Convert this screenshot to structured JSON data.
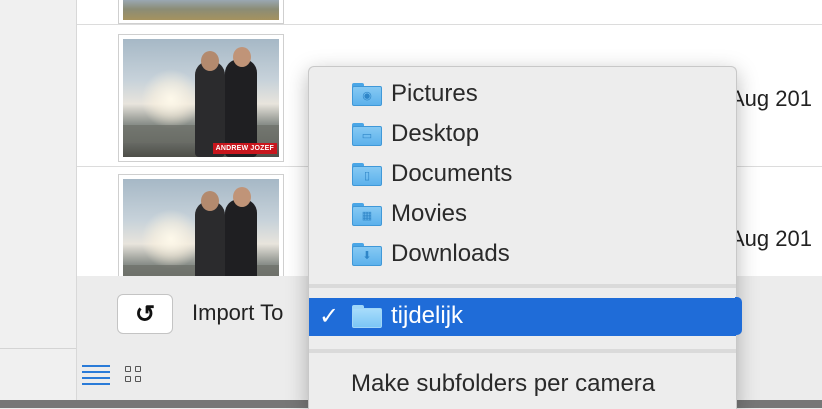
{
  "list": {
    "rows": [
      {
        "date": ""
      },
      {
        "date": "Aug 201",
        "caption": "ANDREW JOZEF"
      },
      {
        "date": "Aug 201"
      }
    ]
  },
  "bottom_bar": {
    "rotate_icon": "rotate-left-icon",
    "import_label": "Import To"
  },
  "popup_menu": {
    "items": [
      {
        "label": "Pictures",
        "icon": "pictures-folder-icon",
        "glyph": "◉"
      },
      {
        "label": "Desktop",
        "icon": "desktop-folder-icon",
        "glyph": "▭"
      },
      {
        "label": "Documents",
        "icon": "documents-folder-icon",
        "glyph": "▯"
      },
      {
        "label": "Movies",
        "icon": "movies-folder-icon",
        "glyph": "▦"
      },
      {
        "label": "Downloads",
        "icon": "downloads-folder-icon",
        "glyph": "⬇"
      }
    ],
    "selected": {
      "label": "tijdelijk",
      "check": "✓",
      "icon": "folder-icon"
    },
    "option": {
      "label": "Make subfolders per camera"
    }
  },
  "colors": {
    "selection": "#1f6cd8",
    "folder": "#5cb1ec",
    "view_icon": "#2a7bd8"
  }
}
